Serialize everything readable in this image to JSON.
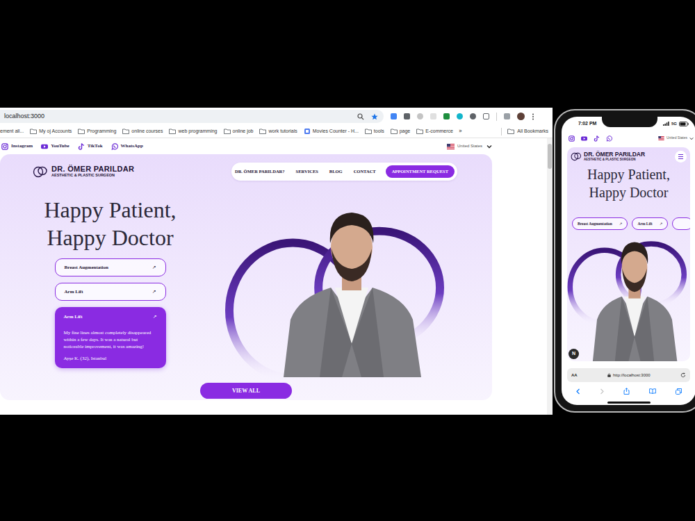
{
  "browser": {
    "url": "localhost:3000",
    "bookmarks": [
      {
        "label": "ement all...",
        "kind": "plain"
      },
      {
        "label": "My oj Accounts",
        "kind": "folder"
      },
      {
        "label": "Programming",
        "kind": "folder"
      },
      {
        "label": "online courses",
        "kind": "folder"
      },
      {
        "label": "web programming",
        "kind": "folder"
      },
      {
        "label": "online job",
        "kind": "folder"
      },
      {
        "label": "work tutorials",
        "kind": "folder"
      },
      {
        "label": "Movies Counter - H...",
        "kind": "page"
      },
      {
        "label": "tools",
        "kind": "folder"
      },
      {
        "label": "page",
        "kind": "folder"
      },
      {
        "label": "E-commerce",
        "kind": "folder"
      }
    ],
    "overflow": "»",
    "all_bookmarks": "All Bookmarks"
  },
  "site": {
    "social": [
      {
        "label": "Instagram",
        "kind": "instagram"
      },
      {
        "label": "YouTube",
        "kind": "youtube"
      },
      {
        "label": "TikTok",
        "kind": "tiktok"
      },
      {
        "label": "WhatsApp",
        "kind": "whatsapp"
      }
    ],
    "region": "United States",
    "logo": {
      "name": "DR. ÖMER PARILDAR",
      "tagline": "AESTHETIC & PLASTIC SURGEON"
    },
    "nav": [
      "DR. ÖMER PARILDAR?",
      "SERVICES",
      "BLOG",
      "CONTACT"
    ],
    "cta": "APPOINTMENT REQUEST",
    "headline": [
      "Happy Patient,",
      "Happy Doctor"
    ],
    "services": [
      {
        "title": "Breast Augmentation",
        "arrow": "↗",
        "expanded": false
      },
      {
        "title": "Arm Lift",
        "arrow": "↗",
        "expanded": false
      },
      {
        "title": "Arm Lift",
        "arrow": "↗",
        "expanded": true,
        "quote": "My fine lines almost completely disappeared within a few days. It was a natural but noticeable improvement, it was amazing!",
        "author": "Ayşe K. (32), Istanbul"
      }
    ],
    "view_all": "VIEW ALL"
  },
  "phone": {
    "time": "7:02 PM",
    "network": "5G",
    "region": "United States",
    "social": [
      {
        "kind": "instagram"
      },
      {
        "kind": "youtube"
      },
      {
        "kind": "tiktok"
      },
      {
        "kind": "whatsapp"
      }
    ],
    "logo": {
      "name": "DR. ÖMER PARILDAR",
      "tagline": "AESTHETIC & PLASTIC SURGEON"
    },
    "headline": [
      "Happy Patient,",
      "Happy Doctor"
    ],
    "services": [
      {
        "title": "Breast Augmentation",
        "arrow": "↗"
      },
      {
        "title": "Arm Lift",
        "arrow": "↗"
      }
    ],
    "badge": "N",
    "address_bar": {
      "text_size": "AA",
      "url": "http://localhost:3000"
    }
  }
}
